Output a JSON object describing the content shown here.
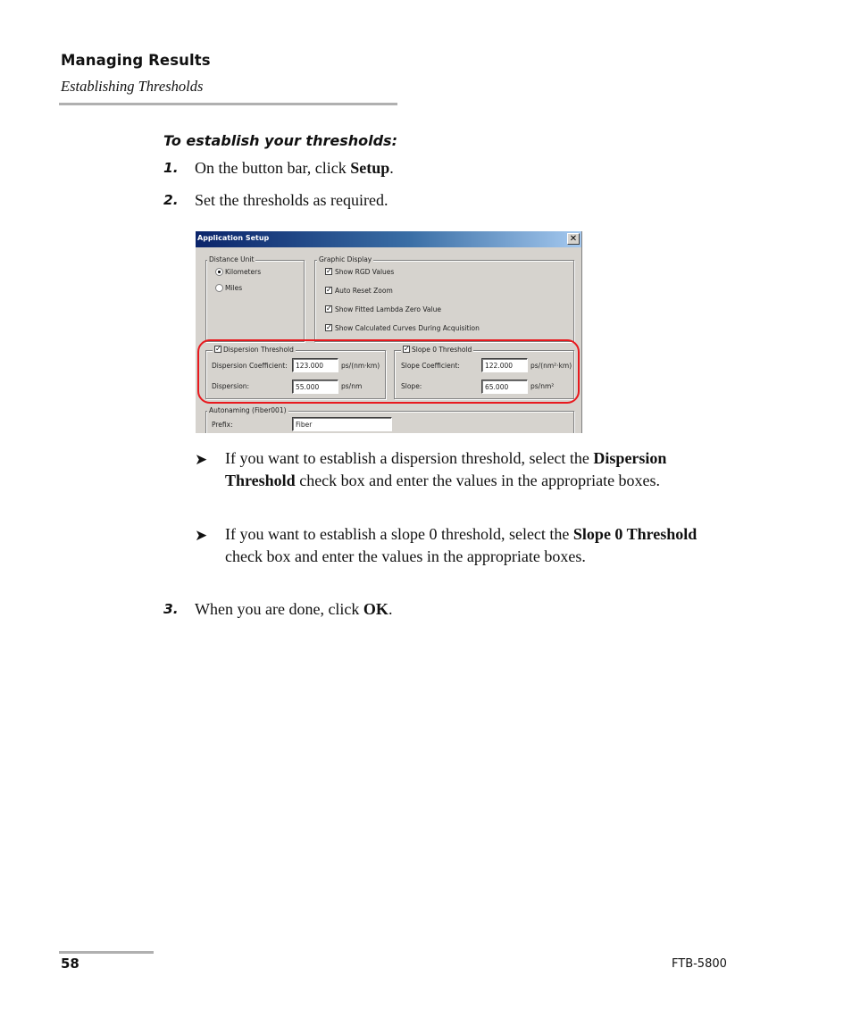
{
  "header": {
    "chapter": "Managing Results",
    "section": "Establishing Thresholds"
  },
  "procedure": {
    "title": "To establish your thresholds:",
    "steps": [
      {
        "num": "1.",
        "pre": "On the button bar, click ",
        "bold": "Setup",
        "post": "."
      },
      {
        "num": "2.",
        "text": "Set the thresholds as required."
      },
      {
        "num": "3.",
        "pre": "When you are done, click ",
        "bold": "OK",
        "post": "."
      }
    ],
    "bullets": [
      {
        "icon": "arrow-bullet-icon",
        "pre": "If you want to establish a dispersion threshold, select the ",
        "bold": "Dispersion Threshold",
        "post": " check box and enter the values in the appropriate boxes."
      },
      {
        "icon": "arrow-bullet-icon",
        "pre": "If you want to establish a slope 0 threshold, select the ",
        "bold": "Slope 0 Threshold",
        "post": " check box and enter the values in the appropriate boxes."
      }
    ]
  },
  "dialog": {
    "title": "Application Setup",
    "close_glyph": "✕",
    "distance_unit": {
      "legend": "Distance Unit",
      "options": [
        {
          "label": "Kilometers",
          "selected": true
        },
        {
          "label": "Miles",
          "selected": false
        }
      ]
    },
    "graphic_display": {
      "legend": "Graphic Display",
      "options": [
        {
          "label": "Show RGD Values",
          "checked": true
        },
        {
          "label": "Auto Reset Zoom",
          "checked": true
        },
        {
          "label": "Show Fitted Lambda Zero Value",
          "checked": true
        },
        {
          "label": "Show Calculated Curves During Acquisition",
          "checked": true
        }
      ]
    },
    "dispersion_threshold": {
      "legend": "Dispersion Threshold",
      "checked": true,
      "coefficient_label": "Dispersion Coefficient:",
      "coefficient_value": "123.000",
      "coefficient_unit": "ps/(nm·km)",
      "dispersion_label": "Dispersion:",
      "dispersion_value": "55.000",
      "dispersion_unit": "ps/nm"
    },
    "slope_threshold": {
      "legend": "Slope 0 Threshold",
      "checked": true,
      "coefficient_label": "Slope Coefficient:",
      "coefficient_value": "122.000",
      "coefficient_unit": "ps/(nm²·km)",
      "slope_label": "Slope:",
      "slope_value": "65.000",
      "slope_unit": "ps/nm²"
    },
    "autonaming": {
      "legend": "Autonaming (Fiber001)",
      "prefix_label": "Prefix:",
      "prefix_value": "Fiber"
    },
    "checkmark": "✓",
    "highlight_color": "#e8191e"
  },
  "footer": {
    "page_number": "58",
    "model": "FTB-5800"
  }
}
